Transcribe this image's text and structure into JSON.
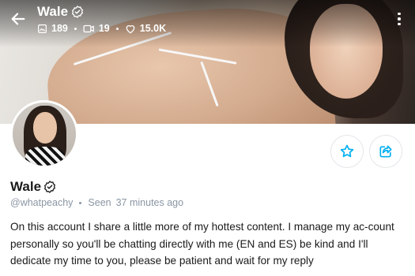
{
  "header": {
    "title": "Wale",
    "stats": {
      "photos": "189",
      "videos": "19",
      "likes": "15.0K"
    }
  },
  "profile": {
    "name": "Wale",
    "handle": "@whatpeachy",
    "seen_label": "Seen",
    "seen_time": "37 minutes ago",
    "bio": "On this account I share a little more of my hottest content. I manage my ac-count personally so you'll be chatting directly with me (EN and ES) be kind and I'll dedicate my time to you, please be patient and wait for my reply"
  },
  "icons": {
    "back": "arrow-left-icon",
    "verified": "verified-badge-icon",
    "photos": "image-icon",
    "videos": "video-icon",
    "likes": "heart-icon",
    "more": "more-vertical-icon",
    "favorite": "star-icon",
    "share": "share-icon"
  },
  "colors": {
    "accent": "#00aff0",
    "muted_text": "#8a96a3",
    "text": "#1a1a1a"
  }
}
